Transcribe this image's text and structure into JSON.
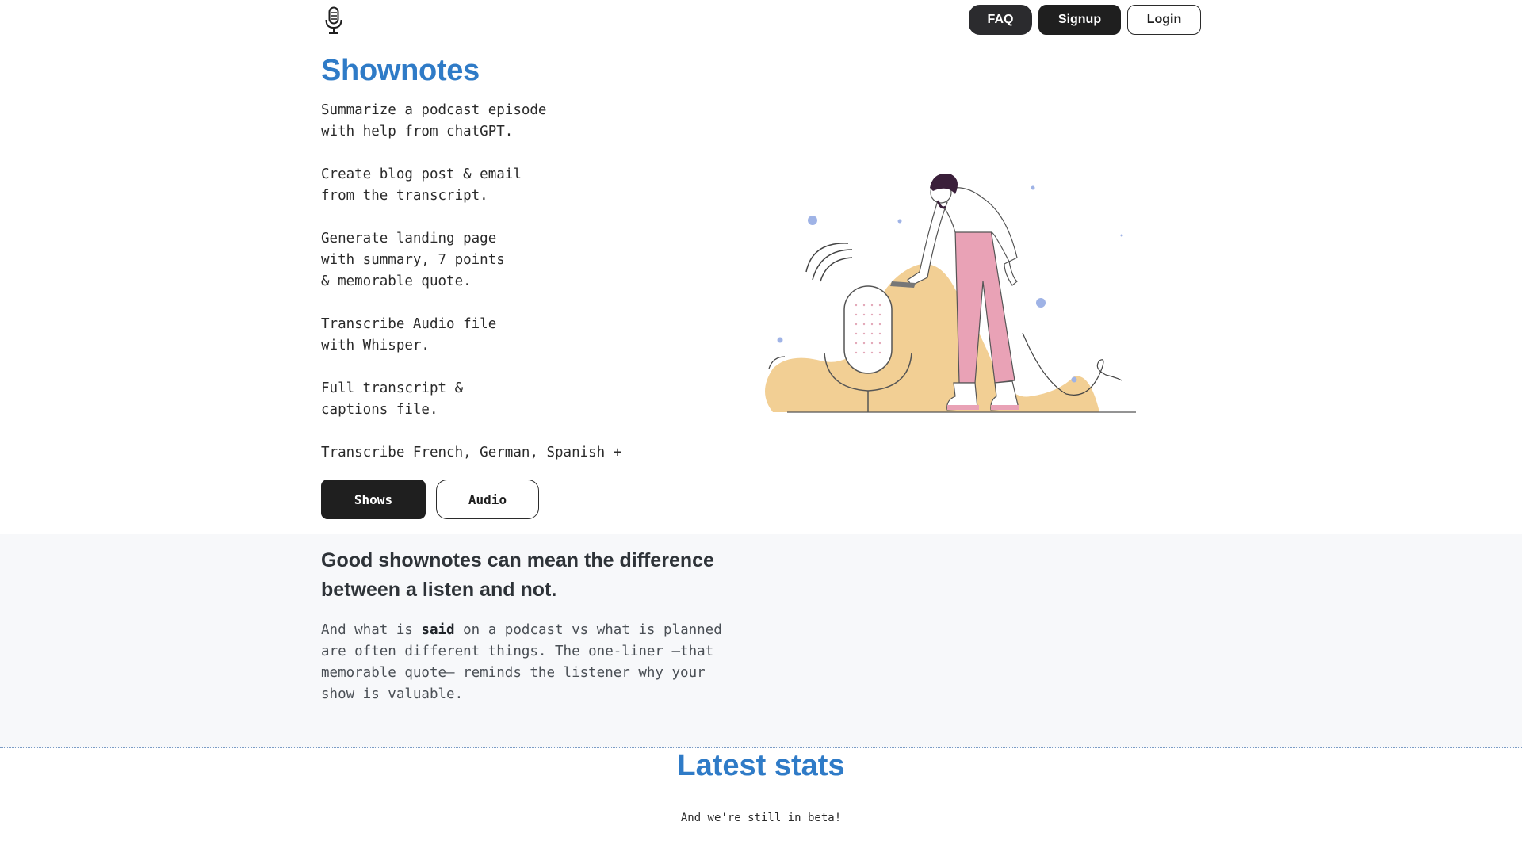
{
  "header": {
    "logo_icon": "microphone-icon",
    "nav": {
      "faq_label": "FAQ",
      "signup_label": "Signup",
      "login_label": "Login"
    }
  },
  "hero": {
    "title": "Shownotes",
    "features": [
      "Summarize a podcast episode\nwith help from chatGPT.",
      "Create blog post & email\nfrom the transcript.",
      "Generate landing page\nwith summary, 7 points\n& memorable quote.",
      "Transcribe Audio file\nwith Whisper.",
      "Full transcript &\ncaptions file.",
      "Transcribe French, German, Spanish +"
    ],
    "buttons": {
      "shows_label": "Shows",
      "audio_label": "Audio"
    },
    "illustration_icon": "podcaster-illustration"
  },
  "why": {
    "heading": "Good shownotes can mean the difference between a listen and not.",
    "body_before": "And what is ",
    "body_emphasis": "said",
    "body_after": " on a podcast vs what is planned\nare often different things. The one-liner —that\nmemorable quote— reminds the listener why your\nshow is valuable."
  },
  "stats": {
    "title": "Latest stats",
    "subtitle": "And we're still in beta!"
  },
  "colors": {
    "accent_blue": "#2f7bc7",
    "button_dark": "#1f1f1f",
    "section_bg": "#f7f8fa",
    "blob_tan": "#f2cf94",
    "pants_pink": "#e9a2b6"
  }
}
